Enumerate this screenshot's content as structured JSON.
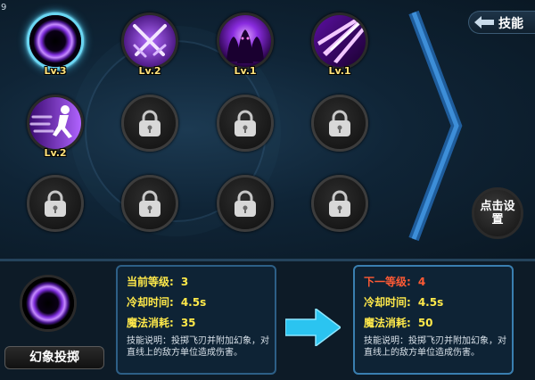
{
  "corner_text": "9",
  "tab_label": "技能",
  "click_settings_label": "点击设置",
  "skills": [
    {
      "name": "phantom-throw",
      "level": "Lv.3",
      "locked": false,
      "selected": true
    },
    {
      "name": "crossed-swords",
      "level": "Lv.2",
      "locked": false,
      "selected": false
    },
    {
      "name": "shadow-clones",
      "level": "Lv.1",
      "locked": false,
      "selected": false
    },
    {
      "name": "slash-burst",
      "level": "Lv.1",
      "locked": false,
      "selected": false
    },
    {
      "name": "dash-runner",
      "level": "Lv.2",
      "locked": false,
      "selected": false
    },
    {
      "name": "locked",
      "level": "",
      "locked": true,
      "selected": false
    }
  ],
  "selected_skill": {
    "name": "幻象投掷"
  },
  "current": {
    "level_label": "当前等级:",
    "level_value": "3",
    "cooldown_label": "冷却时间:",
    "cooldown_value": "4.5s",
    "mana_label": "魔法消耗:",
    "mana_value": "35",
    "description": "技能说明：投掷飞刃并附加幻象，对直线上的敌方单位造成伤害。"
  },
  "next": {
    "level_label": "下一等级:",
    "level_value": "4",
    "cooldown_label": "冷却时间:",
    "cooldown_value": "4.5s",
    "mana_label": "魔法消耗:",
    "mana_value": "50",
    "description": "技能说明：投掷飞刃并附加幻象，对直线上的敌方单位造成伤害。"
  },
  "colors": {
    "accent_cyan": "#45c8f0",
    "level_yellow": "#ffe27a",
    "next_level_red": "#ff5a35",
    "stat_yellow": "#ffe94a",
    "panel_border": "#2d5f86"
  }
}
